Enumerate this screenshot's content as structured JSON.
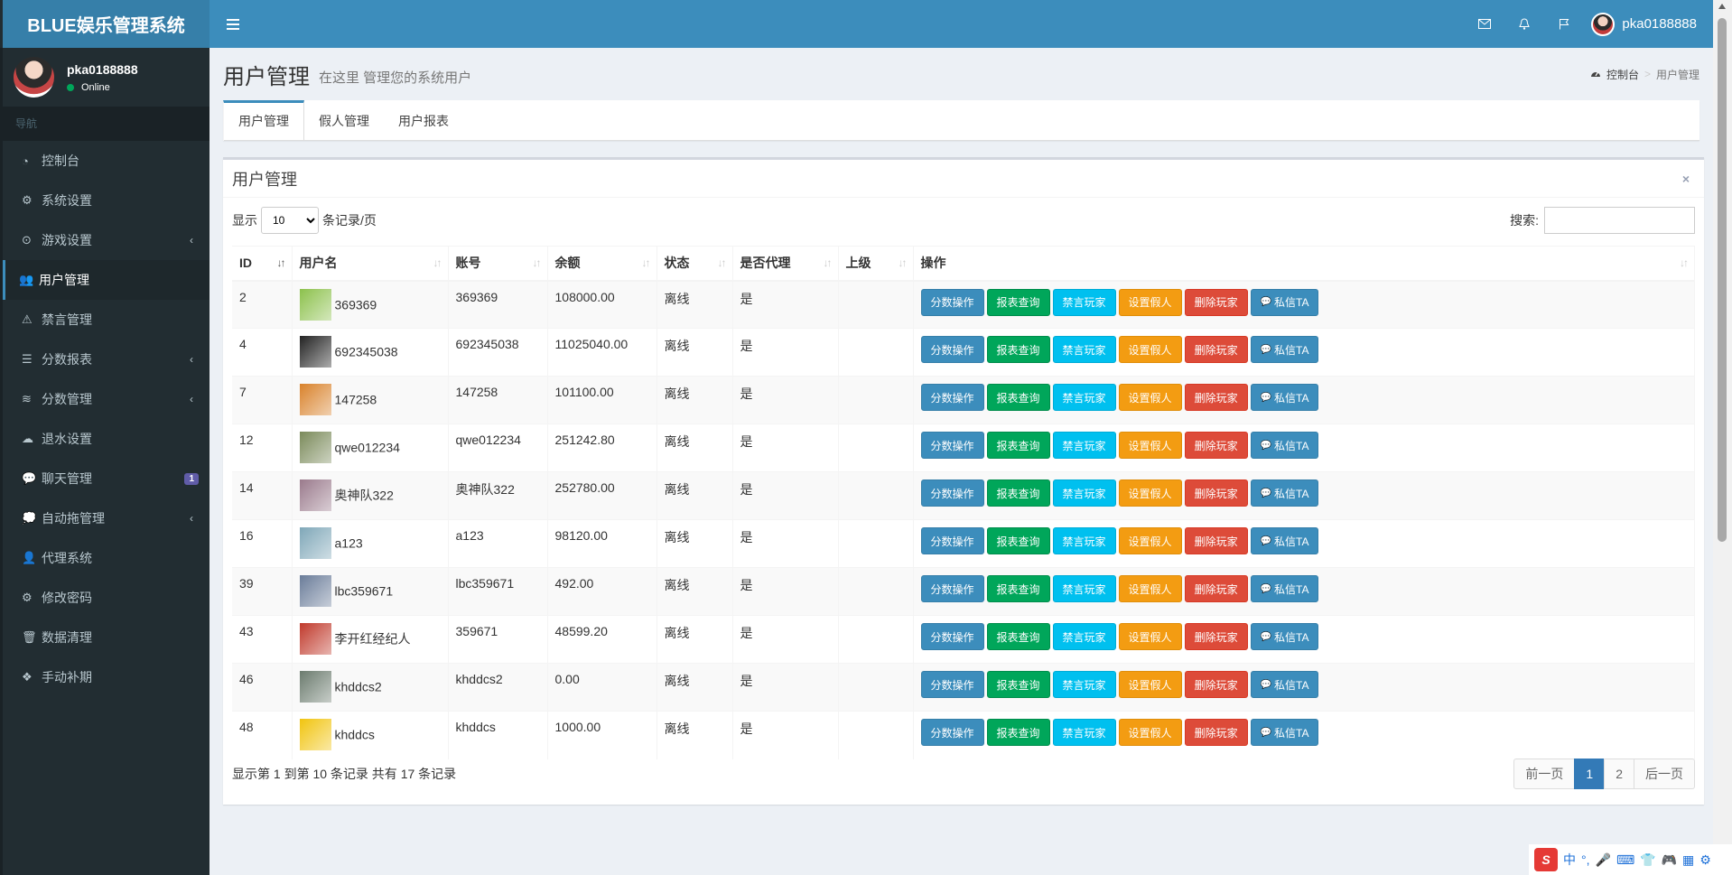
{
  "app": {
    "title": "BLUE娱乐管理系统"
  },
  "navbar": {
    "toggle_icon": "menu-icon",
    "username": "pka0188888"
  },
  "sidebar": {
    "user": {
      "name": "pka0188888",
      "status": "Online"
    },
    "header": "导航",
    "items": [
      {
        "label": "控制台",
        "icon": "dashboard-icon",
        "chevron": false
      },
      {
        "label": "系统设置",
        "icon": "cogs-icon",
        "chevron": false
      },
      {
        "label": "游戏设置",
        "icon": "gamepad-icon",
        "chevron": true
      },
      {
        "label": "用户管理",
        "icon": "users-icon",
        "chevron": false,
        "active": true
      },
      {
        "label": "禁言管理",
        "icon": "warning-icon",
        "chevron": false
      },
      {
        "label": "分数报表",
        "icon": "list-icon",
        "chevron": true
      },
      {
        "label": "分数管理",
        "icon": "database-icon",
        "chevron": true
      },
      {
        "label": "退水设置",
        "icon": "cloud-upload-icon",
        "chevron": false
      },
      {
        "label": "聊天管理",
        "icon": "comments-icon",
        "chevron": false,
        "badge": "1"
      },
      {
        "label": "自动拖管理",
        "icon": "comment-icon",
        "chevron": true
      },
      {
        "label": "代理系统",
        "icon": "user-plus-icon",
        "chevron": false
      },
      {
        "label": "修改密码",
        "icon": "gear-icon",
        "chevron": false
      },
      {
        "label": "数据清理",
        "icon": "trash-icon",
        "chevron": false
      },
      {
        "label": "手动补期",
        "icon": "cubes-icon",
        "chevron": false
      }
    ]
  },
  "header": {
    "title": "用户管理",
    "subtitle": "在这里 管理您的系统用户",
    "breadcrumb": {
      "home": "控制台",
      "separator": ">",
      "current": "用户管理"
    }
  },
  "tabs": [
    "用户管理",
    "假人管理",
    "用户报表"
  ],
  "box": {
    "title": "用户管理",
    "close": "×",
    "show_label": "显示",
    "page_size": "10",
    "per_page_label": "条记录/页",
    "search_label": "搜索:",
    "search_value": ""
  },
  "table": {
    "columns": [
      "ID",
      "用户名",
      "账号",
      "余额",
      "状态",
      "是否代理",
      "上级",
      "操作"
    ],
    "actions": [
      "分数操作",
      "报表查询",
      "禁言玩家",
      "设置假人",
      "删除玩家",
      "私信TA"
    ],
    "rows": [
      {
        "id": "2",
        "username": "369369",
        "account": "369369",
        "balance": "108000.00",
        "status": "离线",
        "agent": "是",
        "parent": "",
        "avatar_color": "#8cc14c"
      },
      {
        "id": "4",
        "username": "692345038",
        "account": "692345038",
        "balance": "11025040.00",
        "status": "离线",
        "agent": "是",
        "parent": "",
        "avatar_color": "#222222"
      },
      {
        "id": "7",
        "username": "147258",
        "account": "147258",
        "balance": "101100.00",
        "status": "离线",
        "agent": "是",
        "parent": "",
        "avatar_color": "#d9822b"
      },
      {
        "id": "12",
        "username": "qwe012234",
        "account": "qwe012234",
        "balance": "251242.80",
        "status": "离线",
        "agent": "是",
        "parent": "",
        "avatar_color": "#7a8a5a"
      },
      {
        "id": "14",
        "username": "奥神队322",
        "account": "奥神队322",
        "balance": "252780.00",
        "status": "离线",
        "agent": "是",
        "parent": "",
        "avatar_color": "#9a7a8c"
      },
      {
        "id": "16",
        "username": "a123",
        "account": "a123",
        "balance": "98120.00",
        "status": "离线",
        "agent": "是",
        "parent": "",
        "avatar_color": "#7fa7b8"
      },
      {
        "id": "39",
        "username": "lbc359671",
        "account": "lbc359671",
        "balance": "492.00",
        "status": "离线",
        "agent": "是",
        "parent": "",
        "avatar_color": "#6a7c99"
      },
      {
        "id": "43",
        "username": "李开红经纪人",
        "account": "359671",
        "balance": "48599.20",
        "status": "离线",
        "agent": "是",
        "parent": "",
        "avatar_color": "#c0392b"
      },
      {
        "id": "46",
        "username": "khddcs2",
        "account": "khddcs2",
        "balance": "0.00",
        "status": "离线",
        "agent": "是",
        "parent": "",
        "avatar_color": "#6b7b6e"
      },
      {
        "id": "48",
        "username": "khddcs",
        "account": "khddcs",
        "balance": "1000.00",
        "status": "离线",
        "agent": "是",
        "parent": "",
        "avatar_color": "#f1c40f"
      }
    ]
  },
  "footer": {
    "info": "显示第 1 到第 10 条记录 共有 17 条记录",
    "prev": "前一页",
    "pages": [
      "1",
      "2"
    ],
    "next": "后一页"
  },
  "ime": {
    "logo": "S",
    "lang": "中"
  },
  "colors": {
    "primary": "#3c8dbc",
    "sidebar": "#222d32",
    "green": "#00a65a",
    "cyan": "#00c0ef",
    "orange": "#f39c12",
    "red": "#dd4b39"
  }
}
